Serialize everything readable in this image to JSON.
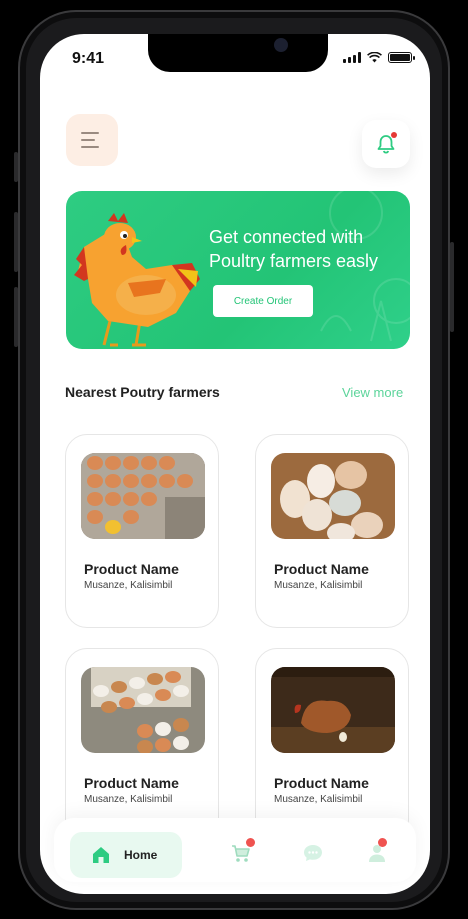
{
  "status_bar": {
    "time": "9:41"
  },
  "banner": {
    "headline": "Get connected with Poultry farmers easly",
    "button_label": "Create Order"
  },
  "section": {
    "title": "Nearest Poutry farmers",
    "view_more": "View more"
  },
  "products": [
    {
      "name": "Product Name",
      "location": "Musanze, Kalisimbil",
      "image": "eggs-in-tray"
    },
    {
      "name": "Product Name",
      "location": "Musanze, Kalisimbil",
      "image": "eggs-in-basket"
    },
    {
      "name": "Product Name",
      "location": "Musanze, Kalisimbil",
      "image": "eggs-in-carton"
    },
    {
      "name": "Product Name",
      "location": "Musanze, Kalisimbil",
      "image": "hen-in-coop"
    }
  ],
  "bottom_nav": {
    "home_label": "Home",
    "items": [
      "home-icon",
      "cart-icon",
      "chat-icon",
      "profile-icon"
    ]
  },
  "colors": {
    "accent_green": "#23c476",
    "menu_bg": "#fdeee4",
    "notification_red": "#e53935"
  }
}
